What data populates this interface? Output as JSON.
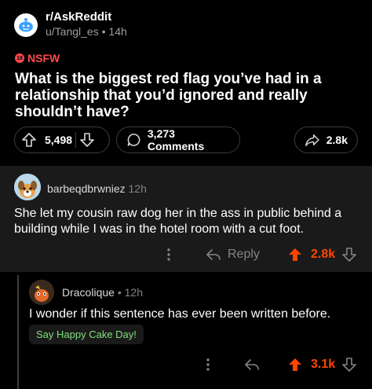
{
  "header": {
    "subreddit": "r/AskReddit",
    "username": "u/Tangl_es",
    "time": "14h",
    "nsfw_badge_short": "18",
    "nsfw_label": "NSFW",
    "title": "What is the biggest red flag you’ve had in a relationship that you’d ignored and really shouldn’t have?"
  },
  "post_actions": {
    "votes": "5,498",
    "comments": "3,273 Comments",
    "shares": "2.8k"
  },
  "comments": [
    {
      "username": "barbeqdbrwniez",
      "time": "12h",
      "body": "She let my cousin raw dog her in the ass in public behind a building while I was in the hotel room with a cut foot.",
      "reply_label": "Reply",
      "score": "2.8k"
    },
    {
      "username": "Dracolique",
      "time": "12h",
      "body": "I wonder if this sentence has ever been written before.",
      "cake_day": "Say Happy Cake Day!",
      "score": "3.1k"
    }
  ],
  "colors": {
    "upvote": "#ff4500",
    "nsfw": "#ff4a4a",
    "cake": "#7fe07a",
    "comment_bg": "#1a1a1b"
  }
}
